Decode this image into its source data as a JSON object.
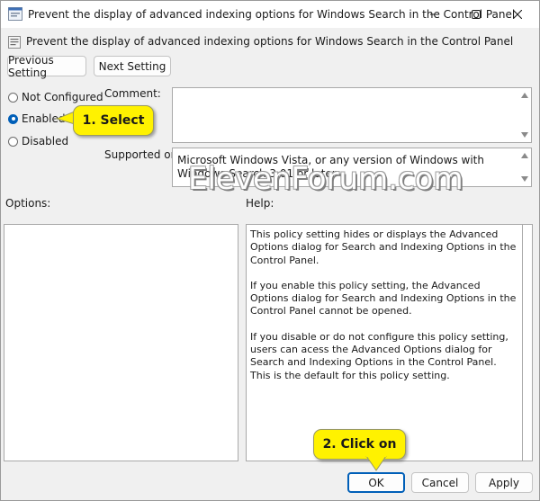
{
  "window": {
    "title": "Prevent the display of advanced indexing options for Windows Search in the Control Panel",
    "subtitle": "Prevent the display of advanced indexing options for Windows Search in the Control Panel"
  },
  "nav": {
    "previous_label": "Previous Setting",
    "next_label": "Next Setting"
  },
  "state": {
    "options": [
      {
        "label": "Not Configured",
        "selected": false
      },
      {
        "label": "Enabled",
        "selected": true
      },
      {
        "label": "Disabled",
        "selected": false
      }
    ]
  },
  "comment": {
    "label": "Comment:",
    "value": ""
  },
  "supported": {
    "label": "Supported on:",
    "value": "Microsoft Windows Vista, or any version of Windows with Windows Search 3.01 or later"
  },
  "options_panel": {
    "label": "Options:"
  },
  "help": {
    "label": "Help:",
    "paragraphs": [
      "This policy setting hides or displays the Advanced Options dialog for Search and Indexing Options in the Control Panel.",
      "If you enable this policy setting, the Advanced Options dialog for Search and Indexing Options in the Control Panel cannot be opened.",
      "If you disable or do not configure this policy setting, users can acess the Advanced Options dialog for Search and Indexing Options in the Control Panel. This is the default for this policy setting."
    ]
  },
  "footer": {
    "ok_label": "OK",
    "cancel_label": "Cancel",
    "apply_label": "Apply"
  },
  "watermark": "ElevenForum.com",
  "callouts": {
    "select": "1. Select",
    "click": "2. Click on"
  },
  "colors": {
    "accent": "#005fb8",
    "callout": "#fff200"
  }
}
